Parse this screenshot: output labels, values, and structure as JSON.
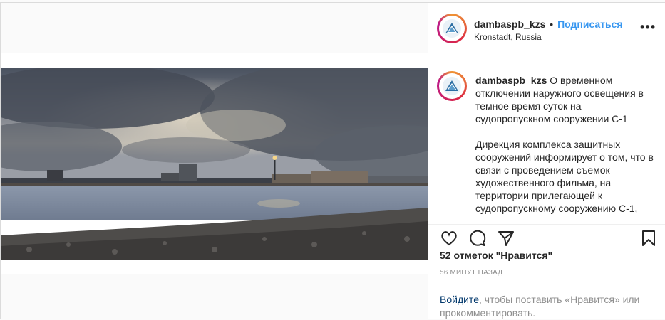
{
  "account": {
    "username": "dambaspb_kzs",
    "separator": "•",
    "follow_label": "Подписаться",
    "location": "Kronstadt, Russia",
    "more_label": "•••"
  },
  "caption": {
    "username": "dambaspb_kzs",
    "paragraph1": "О временном отключении наружного освещения в темное время суток на судопропускном сооружении С-1",
    "paragraph2": "Дирекция комплекса защитных сооружений информирует о том, что в связи с проведением съемок художественного фильма, на территории прилегающей к судопропускному сооружению С-1,"
  },
  "icons": {
    "like": "heart-icon",
    "comment": "comment-icon",
    "share": "share-icon",
    "save": "bookmark-icon"
  },
  "stats": {
    "likes": "52 отметок \"Нравится\"",
    "time": "56 МИНУТ НАЗАД"
  },
  "login": {
    "link": "Войдите",
    "text": ", чтобы поставить «Нравится» или прокомментировать."
  },
  "colors": {
    "link_blue": "#3897f0",
    "login_link": "#00376b",
    "muted": "#8e8e8e"
  }
}
